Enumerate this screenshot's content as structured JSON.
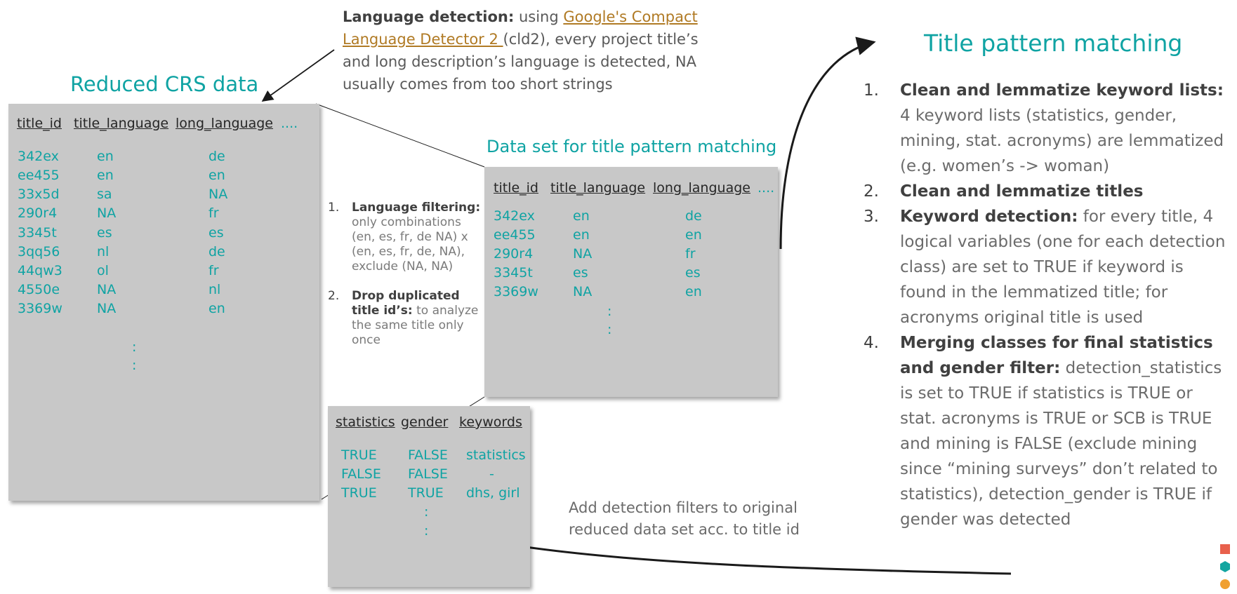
{
  "reduced_crs": {
    "title": "Reduced CRS data",
    "headers": [
      "title_id",
      "title_language",
      "long_language"
    ],
    "more": "....",
    "rows": [
      [
        "342ex",
        "en",
        "de"
      ],
      [
        "ee455",
        "en",
        "en"
      ],
      [
        "33x5d",
        "sa",
        "NA"
      ],
      [
        "290r4",
        "NA",
        "fr"
      ],
      [
        "3345t",
        "es",
        "es"
      ],
      [
        "3qq56",
        "nl",
        "de"
      ],
      [
        "44qw3",
        "ol",
        "fr"
      ],
      [
        "4550e",
        "NA",
        "nl"
      ],
      [
        "3369w",
        "NA",
        "en"
      ]
    ],
    "continuation": [
      ":",
      ":"
    ]
  },
  "language_detection": {
    "bold": "Language detection:",
    "pre_link": " using ",
    "link": "Google's Compact Language Detector 2 ",
    "post_link": "(cld2), every project title’s and long description’s language is detected, NA usually comes from too short strings"
  },
  "filters": [
    {
      "num": "1.",
      "bold": "Language filtering:",
      "text": " only combinations (en, es, fr, de NA) x (en, es, fr, de, NA), exclude (NA, NA)"
    },
    {
      "num": "2.",
      "bold": "Drop duplicated title id’s:",
      "text": " to analyze the same title only once"
    }
  ],
  "title_dataset": {
    "title": "Data set for title pattern matching",
    "headers": [
      "title_id",
      "title_language",
      "long_language"
    ],
    "more": "....",
    "rows": [
      [
        "342ex",
        "en",
        "de"
      ],
      [
        "ee455",
        "en",
        "en"
      ],
      [
        "290r4",
        "NA",
        "fr"
      ],
      [
        "3345t",
        "es",
        "es"
      ],
      [
        "3369w",
        "NA",
        "en"
      ]
    ],
    "continuation": [
      ":",
      ":"
    ]
  },
  "detection_table": {
    "headers": [
      "statistics",
      "gender",
      "keywords"
    ],
    "rows": [
      [
        "TRUE",
        "FALSE",
        "statistics"
      ],
      [
        "FALSE",
        "FALSE",
        "-"
      ],
      [
        "TRUE",
        "TRUE",
        "dhs, girl"
      ]
    ],
    "continuation": [
      ":",
      ":"
    ]
  },
  "add_filters_note": "Add detection filters to original reduced data set acc. to title id",
  "title_pattern": {
    "title": "Title pattern matching",
    "steps": [
      {
        "num": "1.",
        "bold": "Clean and lemmatize keyword lists:",
        "text": " 4 keyword lists (statistics, gender, mining, stat. acronyms) are lemmatized (e.g. women’s -> woman)"
      },
      {
        "num": "2.",
        "bold": "Clean and lemmatize titles",
        "text": ""
      },
      {
        "num": "3.",
        "bold": "Keyword detection:",
        "text": " for every title, 4 logical variables (one for each detection class) are set to TRUE if keyword is found in the lemmatized title; for acronyms original title is used"
      },
      {
        "num": "4.",
        "bold": "Merging classes for final statistics and gender filter:",
        "text": " detection_statistics is set to TRUE if statistics is TRUE or stat. acronyms is TRUE or SCB is TRUE and mining is FALSE (exclude mining since “mining surveys” don’t related to statistics), detection_gender is TRUE if gender was detected"
      }
    ]
  },
  "colors": {
    "teal": "#0fa3a3",
    "panel_gray": "#c8c8c8",
    "link_brown": "#b07a24",
    "corner_red": "#e8604c",
    "corner_teal": "#12a5a0",
    "corner_orange": "#f0a030"
  }
}
